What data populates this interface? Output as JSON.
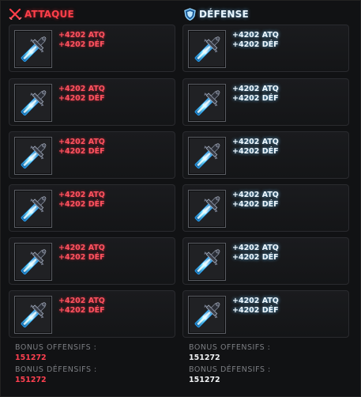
{
  "headers": {
    "attack": "ATTAQUE",
    "defense": "DÉFENSE"
  },
  "attack_items": [
    {
      "atq": "+4202 ATQ",
      "def": "+4202 DÉF"
    },
    {
      "atq": "+4202 ATQ",
      "def": "+4202 DÉF"
    },
    {
      "atq": "+4202 ATQ",
      "def": "+4202 DÉF"
    },
    {
      "atq": "+4202 ATQ",
      "def": "+4202 DÉF"
    },
    {
      "atq": "+4202 ATQ",
      "def": "+4202 DÉF"
    },
    {
      "atq": "+4202 ATQ",
      "def": "+4202 DÉF"
    }
  ],
  "defense_items": [
    {
      "atq": "+4202 ATQ",
      "def": "+4202 DÉF"
    },
    {
      "atq": "+4202 ATQ",
      "def": "+4202 DÉF"
    },
    {
      "atq": "+4202 ATQ",
      "def": "+4202 DÉF"
    },
    {
      "atq": "+4202 ATQ",
      "def": "+4202 DÉF"
    },
    {
      "atq": "+4202 ATQ",
      "def": "+4202 DÉF"
    },
    {
      "atq": "+4202 ATQ",
      "def": "+4202 DÉF"
    }
  ],
  "bonus": {
    "attack": {
      "offense_label": "BONUS OFFENSIFS :",
      "offense_value": "151272",
      "defense_label": "BONUS DÉFENSIFS :",
      "defense_value": "151272"
    },
    "defense": {
      "offense_label": "BONUS OFFENSIFS :",
      "offense_value": "151272",
      "defense_label": "BONUS DÉFENSIFS :",
      "defense_value": "151272"
    }
  },
  "icons": {
    "attack_header": "crossed-swords-icon",
    "defense_header": "shield-icon",
    "item": "glowing-sword-icon"
  },
  "colors": {
    "attack": "#ff3f4a",
    "defense_glow": "#6ec8ff",
    "bonus_label": "#7b7d82"
  }
}
